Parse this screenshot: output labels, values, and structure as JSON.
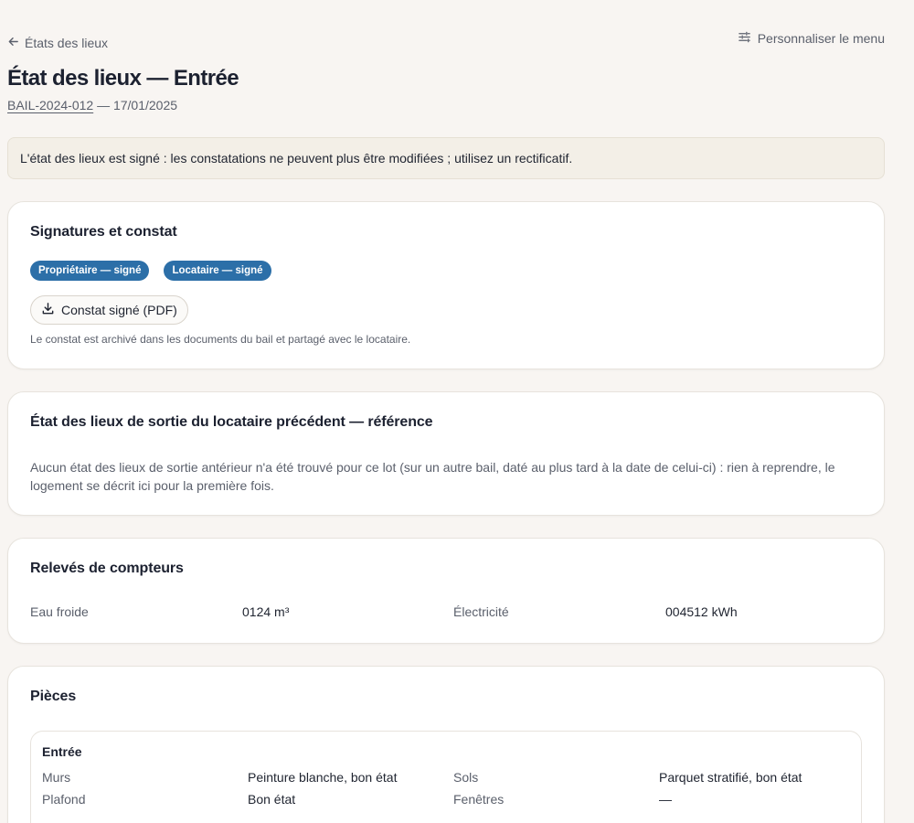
{
  "nav": {
    "back_label": "États des lieux",
    "customize_label": "Personnaliser le menu"
  },
  "header": {
    "title": "État des lieux — Entrée",
    "lease_ref": "BAIL-2024-012",
    "date_suffix": " — 17/01/2025"
  },
  "notice": {
    "text": "L'état des lieux est signé : les constatations ne peuvent plus être modifiées ; utilisez un rectificatif."
  },
  "signatures": {
    "title": "Signatures et constat",
    "badges": [
      "Propriétaire — signé",
      "Locataire — signé"
    ],
    "pdf_button": "Constat signé (PDF)",
    "hint": "Le constat est archivé dans les documents du bail et partagé avec le locataire."
  },
  "reference": {
    "title": "État des lieux de sortie du locataire précédent — référence",
    "text": "Aucun état des lieux de sortie antérieur n'a été trouvé pour ce lot (sur un autre bail, daté au plus tard à la date de celui-ci) : rien à reprendre, le logement se décrit ici pour la première fois."
  },
  "meters": {
    "title": "Relevés de compteurs",
    "items": [
      {
        "label": "Eau froide",
        "value": "0124 m³"
      },
      {
        "label": "Électricité",
        "value": "004512 kWh"
      }
    ]
  },
  "rooms": {
    "title": "Pièces",
    "list": [
      {
        "name": "Entrée",
        "rows": [
          [
            {
              "label": "Murs",
              "value": "Peinture blanche, bon état"
            },
            {
              "label": "Sols",
              "value": "Parquet stratifié, bon état"
            }
          ],
          [
            {
              "label": "Plafond",
              "value": "Bon état"
            },
            {
              "label": "Fenêtres",
              "value": "—"
            }
          ]
        ]
      }
    ]
  },
  "colors": {
    "badge": "#2c6fa8",
    "background": "#f8f5f2",
    "notice_bg": "#f3efe7"
  }
}
